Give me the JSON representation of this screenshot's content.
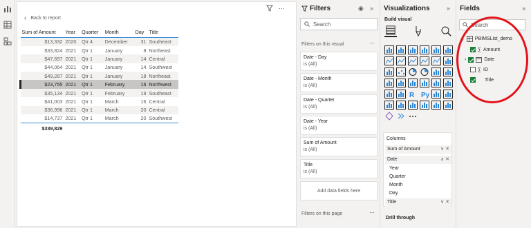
{
  "report": {
    "back_label": "Back to report",
    "columns": [
      "Sum of Amount",
      "Year",
      "Quarter",
      "Month",
      "Day",
      "Title"
    ],
    "rows": [
      [
        "$13,332",
        "2020",
        "Qtr 4",
        "December",
        "31",
        "Southeast"
      ],
      [
        "$33,824",
        "2021",
        "Qtr 1",
        "January",
        "8",
        "Northeast"
      ],
      [
        "$47,697",
        "2021",
        "Qtr 1",
        "January",
        "14",
        "Central"
      ],
      [
        "$44,064",
        "2021",
        "Qtr 1",
        "January",
        "14",
        "Southwest"
      ],
      [
        "$49,287",
        "2021",
        "Qtr 1",
        "January",
        "18",
        "Northeast"
      ],
      [
        "$23,755",
        "2021",
        "Qtr 1",
        "February",
        "16",
        "Northwest"
      ],
      [
        "$35,134",
        "2021",
        "Qtr 1",
        "February",
        "19",
        "Southeast"
      ],
      [
        "$41,003",
        "2021",
        "Qtr 1",
        "March",
        "16",
        "Central"
      ],
      [
        "$36,996",
        "2021",
        "Qtr 1",
        "March",
        "20",
        "Central"
      ],
      [
        "$14,737",
        "2021",
        "Qtr 1",
        "March",
        "20",
        "Southwest"
      ]
    ],
    "selected_row": 5,
    "total": "$339,829"
  },
  "filters": {
    "title": "Filters",
    "search_placeholder": "Search",
    "on_visual_label": "Filters on this visual",
    "cards": [
      {
        "name": "Date - Day",
        "value": "is (All)"
      },
      {
        "name": "Date - Month",
        "value": "is (All)"
      },
      {
        "name": "Date - Quarter",
        "value": "is (All)"
      },
      {
        "name": "Date - Year",
        "value": "is (All)"
      },
      {
        "name": "Sum of Amount",
        "value": "is (All)"
      },
      {
        "name": "Title",
        "value": "is (All)"
      }
    ],
    "add_fields_label": "Add data fields here",
    "on_page_label": "Filters on this page"
  },
  "visualizations": {
    "title": "Visualizations",
    "build_visual_label": "Build visual",
    "columns_label": "Columns",
    "wells": {
      "sum_of_amount": "Sum of Amount",
      "date": "Date",
      "date_parts": [
        "Year",
        "Quarter",
        "Month",
        "Day"
      ],
      "title": "Title"
    },
    "drill_through_label": "Drill through"
  },
  "fields": {
    "title": "Fields",
    "search_placeholder": "Search",
    "table_name": "PBIMSList_demo",
    "items": [
      {
        "label": "Amount",
        "checked": true,
        "sigma": true
      },
      {
        "label": "Date",
        "checked": true,
        "sigma": false
      },
      {
        "label": "ID",
        "checked": false,
        "sigma": true
      },
      {
        "label": "Title",
        "checked": true,
        "sigma": false
      }
    ]
  },
  "colors": {
    "accent": "#2b88d8",
    "annotation": "#e3131a",
    "checked": "#1b7f3a"
  }
}
